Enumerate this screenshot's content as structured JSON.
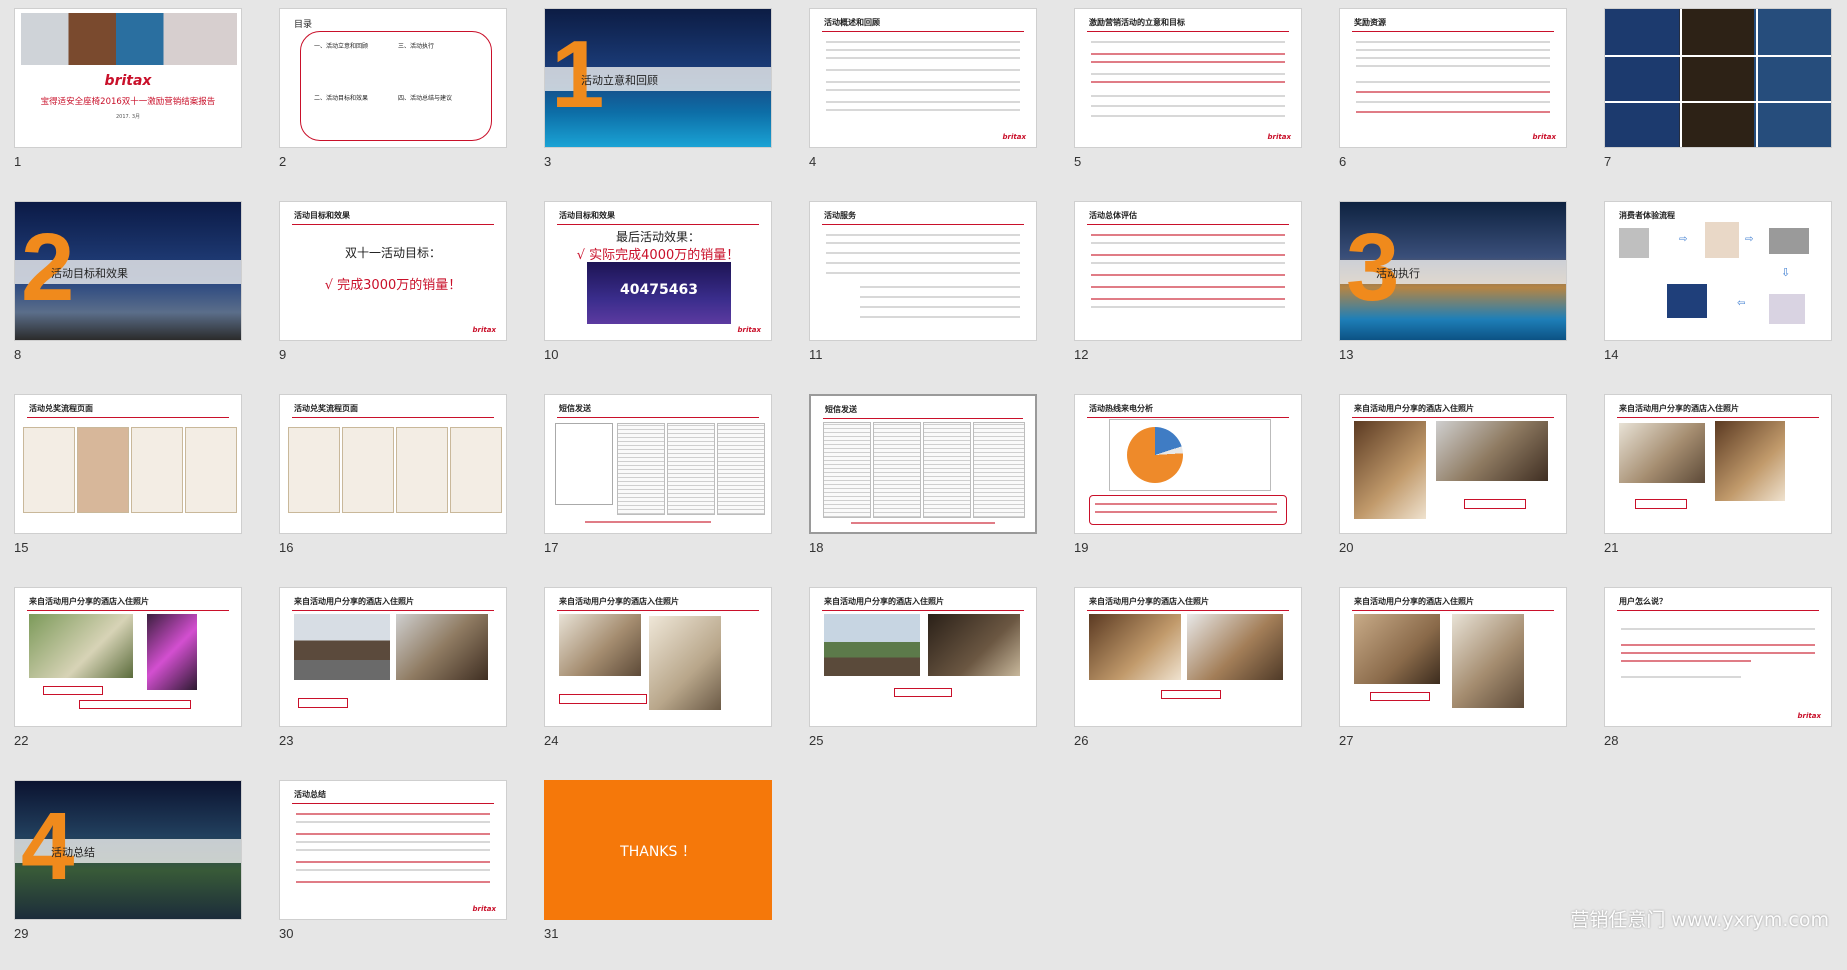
{
  "slides": [
    {
      "num": "1",
      "title": "宝得适安全座椅2016双十一激励营销结案报告",
      "brand": "britax",
      "date": "2017. 3月"
    },
    {
      "num": "2",
      "title": "目录",
      "toc": [
        "一、活动立意和回顾",
        "二、活动目标和效果",
        "三、活动执行",
        "四、活动总结与建议"
      ]
    },
    {
      "num": "3",
      "section_no": "1",
      "section": "活动立意和回顾"
    },
    {
      "num": "4",
      "title": "活动概述和回顾"
    },
    {
      "num": "5",
      "title": "激励营销活动的立意和目标"
    },
    {
      "num": "6",
      "title": "奖励资源"
    },
    {
      "num": "7"
    },
    {
      "num": "8",
      "section_no": "2",
      "section": "活动目标和效果"
    },
    {
      "num": "9",
      "title": "活动目标和效果",
      "headline": "双十一活动目标：",
      "highlight": "√ 完成3000万的销量！"
    },
    {
      "num": "10",
      "title": "活动目标和效果",
      "headline": "最后活动效果：",
      "highlight": "√ 实际完成4000万的销量！",
      "figure": "40475463"
    },
    {
      "num": "11",
      "title": "活动服务"
    },
    {
      "num": "12",
      "title": "活动总体评估"
    },
    {
      "num": "13",
      "section_no": "3",
      "section": "活动执行"
    },
    {
      "num": "14",
      "title": "消费者体验流程"
    },
    {
      "num": "15",
      "title": "活动兑奖流程页面"
    },
    {
      "num": "16",
      "title": "活动兑奖流程页面"
    },
    {
      "num": "17",
      "title": "短信发送"
    },
    {
      "num": "18",
      "title": "短信发送"
    },
    {
      "num": "19",
      "title": "活动热线来电分析"
    },
    {
      "num": "20",
      "title": "来自活动用户分享的酒店入住照片"
    },
    {
      "num": "21",
      "title": "来自活动用户分享的酒店入住照片"
    },
    {
      "num": "22",
      "title": "来自活动用户分享的酒店入住照片"
    },
    {
      "num": "23",
      "title": "来自活动用户分享的酒店入住照片"
    },
    {
      "num": "24",
      "title": "来自活动用户分享的酒店入住照片"
    },
    {
      "num": "25",
      "title": "来自活动用户分享的酒店入住照片"
    },
    {
      "num": "26",
      "title": "来自活动用户分享的酒店入住照片"
    },
    {
      "num": "27",
      "title": "来自活动用户分享的酒店入住照片"
    },
    {
      "num": "28",
      "title": "用户怎么说？"
    },
    {
      "num": "29",
      "section_no": "4",
      "section": "活动总结"
    },
    {
      "num": "30",
      "title": "活动总结"
    },
    {
      "num": "31",
      "thanks": "THANKS ！"
    }
  ],
  "logo": "britax",
  "watermark": "营销任意门 www.yxrym.com",
  "colors": {
    "accent": "#c9102a",
    "orange": "#f08a1c",
    "thanks_bg": "#f5780a"
  }
}
